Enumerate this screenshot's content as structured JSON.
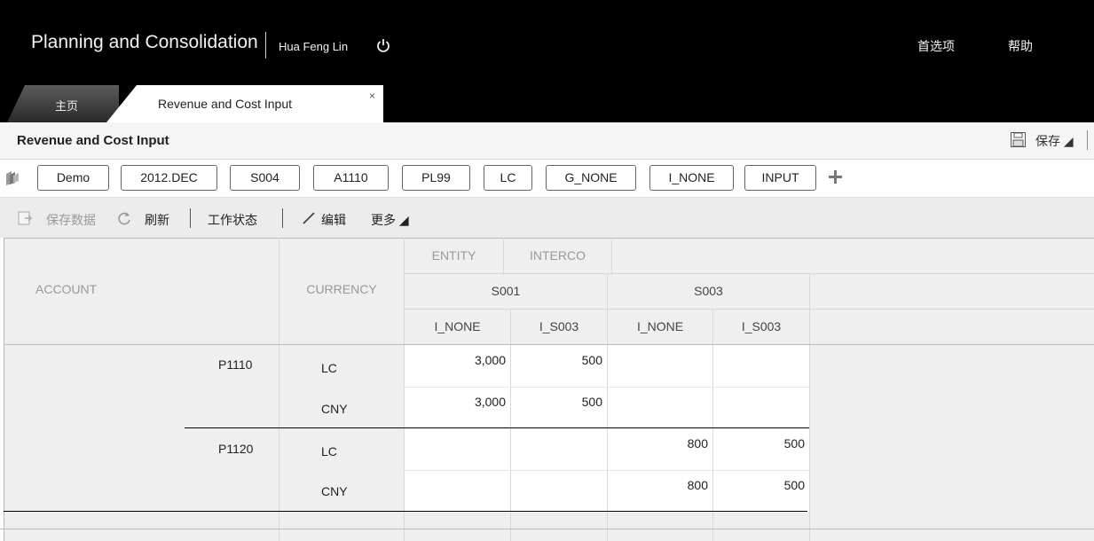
{
  "header": {
    "app_title": "Planning and Consolidation",
    "user_name": "Hua Feng Lin",
    "links": {
      "preferences": "首选项",
      "help": "帮助"
    }
  },
  "tabs": [
    {
      "label": "主页",
      "active": false
    },
    {
      "label": "Revenue and Cost Input",
      "active": true,
      "close": "×"
    }
  ],
  "page": {
    "title": "Revenue and Cost Input",
    "save_label": "保存 ◢"
  },
  "dimensions": [
    "Demo",
    "2012.DEC",
    "S004",
    "A1110",
    "PL99",
    "LC",
    "G_NONE",
    "I_NONE",
    "INPUT"
  ],
  "toolbar": {
    "save_data": "保存数据",
    "refresh": "刷新",
    "work_status": "工作状态",
    "edit": "编辑",
    "more": "更多 ◢"
  },
  "grid": {
    "row_headers": {
      "account": "ACCOUNT",
      "currency": "CURRENCY"
    },
    "col_dims": {
      "entity": "ENTITY",
      "interco": "INTERCO"
    },
    "entities": [
      {
        "name": "S001",
        "intercos": [
          "I_NONE",
          "I_S003"
        ]
      },
      {
        "name": "S003",
        "intercos": [
          "I_NONE",
          "I_S003"
        ]
      }
    ],
    "rows": [
      {
        "account": "P1110",
        "currency": "LC",
        "values": [
          "3,000",
          "500",
          "",
          ""
        ]
      },
      {
        "account": "",
        "currency": "CNY",
        "values": [
          "3,000",
          "500",
          "",
          ""
        ]
      },
      {
        "account": "P1120",
        "currency": "LC",
        "values": [
          "",
          "",
          "800",
          "500"
        ]
      },
      {
        "account": "",
        "currency": "CNY",
        "values": [
          "",
          "",
          "800",
          "500"
        ]
      }
    ]
  }
}
